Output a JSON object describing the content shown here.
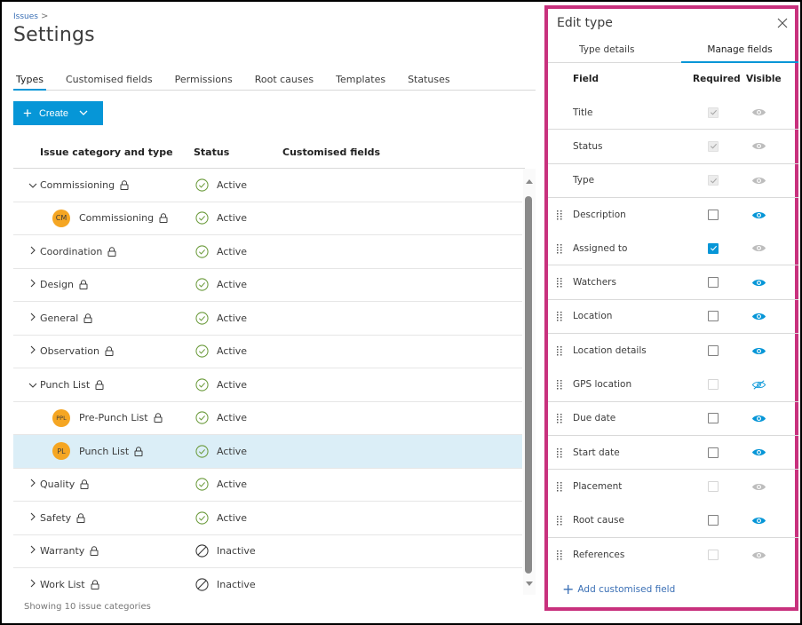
{
  "breadcrumb": {
    "parent": "Issues",
    "separator": ">"
  },
  "page": {
    "title": "Settings"
  },
  "tabs": [
    {
      "label": "Types",
      "active": true
    },
    {
      "label": "Customised fields",
      "active": false
    },
    {
      "label": "Permissions",
      "active": false
    },
    {
      "label": "Root causes",
      "active": false
    },
    {
      "label": "Templates",
      "active": false
    },
    {
      "label": "Statuses",
      "active": false
    }
  ],
  "create_button": {
    "label": "Create",
    "icon": "plus-icon",
    "dropdown_icon": "chevron-down-icon"
  },
  "table": {
    "headers": {
      "name": "Issue category and type",
      "status": "Status",
      "custom_fields": "Customised fields"
    },
    "rows": [
      {
        "name": "Commissioning",
        "level": "category",
        "expanded": true,
        "locked": true,
        "status": "Active"
      },
      {
        "name": "Commissioning",
        "level": "type",
        "avatar": "CM",
        "locked": true,
        "status": "Active"
      },
      {
        "name": "Coordination",
        "level": "category",
        "expanded": false,
        "locked": true,
        "status": "Active"
      },
      {
        "name": "Design",
        "level": "category",
        "expanded": false,
        "locked": true,
        "status": "Active"
      },
      {
        "name": "General",
        "level": "category",
        "expanded": false,
        "locked": true,
        "status": "Active"
      },
      {
        "name": "Observation",
        "level": "category",
        "expanded": false,
        "locked": true,
        "status": "Active"
      },
      {
        "name": "Punch List",
        "level": "category",
        "expanded": true,
        "locked": true,
        "status": "Active"
      },
      {
        "name": "Pre-Punch List",
        "level": "type",
        "avatar": "PPL",
        "locked": true,
        "status": "Active"
      },
      {
        "name": "Punch List",
        "level": "type",
        "avatar": "PL",
        "locked": true,
        "status": "Active",
        "selected": true
      },
      {
        "name": "Quality",
        "level": "category",
        "expanded": false,
        "locked": true,
        "status": "Active"
      },
      {
        "name": "Safety",
        "level": "category",
        "expanded": false,
        "locked": true,
        "status": "Active"
      },
      {
        "name": "Warranty",
        "level": "category",
        "expanded": false,
        "locked": true,
        "status": "Inactive"
      },
      {
        "name": "Work List",
        "level": "category",
        "expanded": false,
        "locked": true,
        "status": "Inactive"
      }
    ],
    "footer": "Showing 10 issue categories"
  },
  "panel": {
    "title": "Edit type",
    "close_icon": "close-icon",
    "tabs": [
      {
        "label": "Type details",
        "active": false
      },
      {
        "label": "Manage fields",
        "active": true
      }
    ],
    "headers": {
      "field": "Field",
      "required": "Required",
      "visible": "Visible"
    },
    "fields": [
      {
        "name": "Title",
        "draggable": false,
        "required": "locked-checked",
        "visible": "locked"
      },
      {
        "name": "Status",
        "draggable": false,
        "required": "locked-checked",
        "visible": "locked"
      },
      {
        "name": "Type",
        "draggable": false,
        "required": "locked-checked",
        "visible": "locked"
      },
      {
        "name": "Description",
        "draggable": true,
        "required": "unchecked",
        "visible": "on"
      },
      {
        "name": "Assigned to",
        "draggable": true,
        "required": "checked",
        "visible": "locked"
      },
      {
        "name": "Watchers",
        "draggable": true,
        "required": "unchecked",
        "visible": "on"
      },
      {
        "name": "Location",
        "draggable": true,
        "required": "unchecked",
        "visible": "on"
      },
      {
        "name": "Location details",
        "draggable": true,
        "required": "unchecked",
        "visible": "on"
      },
      {
        "name": "GPS location",
        "draggable": true,
        "required": "disabled",
        "visible": "off"
      },
      {
        "name": "Due date",
        "draggable": true,
        "required": "unchecked",
        "visible": "on"
      },
      {
        "name": "Start date",
        "draggable": true,
        "required": "unchecked",
        "visible": "on"
      },
      {
        "name": "Placement",
        "draggable": true,
        "required": "disabled",
        "visible": "locked"
      },
      {
        "name": "Root cause",
        "draggable": true,
        "required": "unchecked",
        "visible": "on"
      },
      {
        "name": "References",
        "draggable": true,
        "required": "disabled",
        "visible": "locked"
      }
    ],
    "add_field_label": "Add customised field"
  },
  "colors": {
    "accent": "#0696d7",
    "active_status": "#6a9a3a",
    "avatar": "#f5a623",
    "panel_border": "#c8317d",
    "selected_row": "#dbeef7",
    "link": "#3a6fb5"
  }
}
